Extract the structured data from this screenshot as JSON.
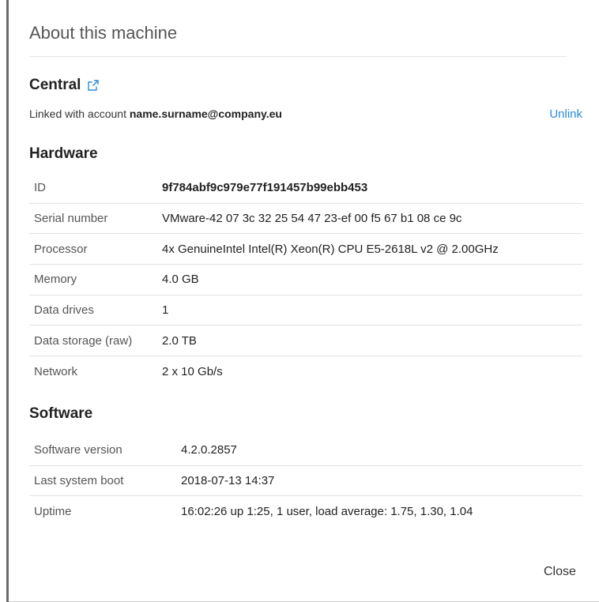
{
  "dialog": {
    "title": "About this machine",
    "close_label": "Close"
  },
  "central": {
    "heading": "Central",
    "linked_prefix": "Linked with account ",
    "account": "name.surname@company.eu",
    "unlink_label": "Unlink"
  },
  "hardware": {
    "heading": "Hardware",
    "rows": [
      {
        "label": "ID",
        "value": "9f784abf9c979e77f191457b99ebb453"
      },
      {
        "label": "Serial number",
        "value": "VMware-42 07 3c 32 25 54 47 23-ef 00 f5 67 b1 08 ce 9c"
      },
      {
        "label": "Processor",
        "value": "4x GenuineIntel Intel(R) Xeon(R) CPU E5-2618L v2 @ 2.00GHz"
      },
      {
        "label": "Memory",
        "value": "4.0 GB"
      },
      {
        "label": "Data drives",
        "value": "1"
      },
      {
        "label": "Data storage (raw)",
        "value": "2.0 TB"
      },
      {
        "label": "Network",
        "value": "2 x 10 Gb/s"
      }
    ]
  },
  "software": {
    "heading": "Software",
    "rows": [
      {
        "label": "Software version",
        "value": "4.2.0.2857"
      },
      {
        "label": "Last system boot",
        "value": "2018-07-13 14:37"
      },
      {
        "label": "Uptime",
        "value": "16:02:26 up 1:25, 1 user, load average: 1.75, 1.30, 1.04"
      }
    ]
  },
  "colors": {
    "link": "#2a8ad8",
    "divider": "#e2e2e2"
  },
  "icons": {
    "central_link": "external-link-icon"
  }
}
